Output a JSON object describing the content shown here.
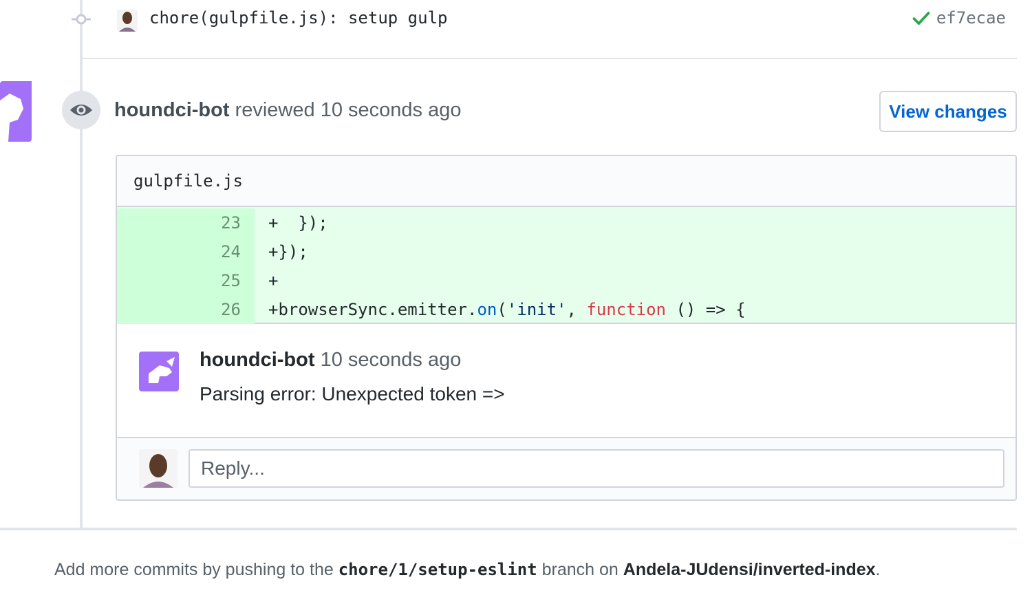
{
  "commit": {
    "message": "chore(gulpfile.js): setup gulp",
    "sha": "ef7ecae",
    "status_icon": "check-icon"
  },
  "review": {
    "author": "houndci-bot",
    "action": " reviewed ",
    "time": "10 seconds ago",
    "view_changes_label": "View changes",
    "icon": "eye-icon"
  },
  "file": {
    "name": "gulpfile.js",
    "lines": [
      {
        "num": "23"
      },
      {
        "num": "24"
      },
      {
        "num": "25"
      },
      {
        "num": "26"
      }
    ],
    "code": {
      "l23": "+  });",
      "l24": "+});",
      "l25": "+",
      "l26_a": "+browserSync.emitter.",
      "l26_on": "on",
      "l26_paren": "(",
      "l26_str": "'init'",
      "l26_comma": ", ",
      "l26_kw": "function",
      "l26_rest": " () => {"
    }
  },
  "comment": {
    "author": "houndci-bot",
    "time": " 10 seconds ago",
    "body": "Parsing error: Unexpected token =>"
  },
  "reply": {
    "placeholder": "Reply..."
  },
  "footer": {
    "prefix": "Add more commits by pushing to the ",
    "branch": "chore/1/setup-eslint",
    "middle": " branch on ",
    "repo": "Andela-JUdensi/inverted-index",
    "suffix": "."
  },
  "colors": {
    "bot_avatar": "#a371f7",
    "link": "#0366d6",
    "success": "#28a745",
    "added_bg": "#e6ffed",
    "added_num_bg": "#cdffd8"
  }
}
